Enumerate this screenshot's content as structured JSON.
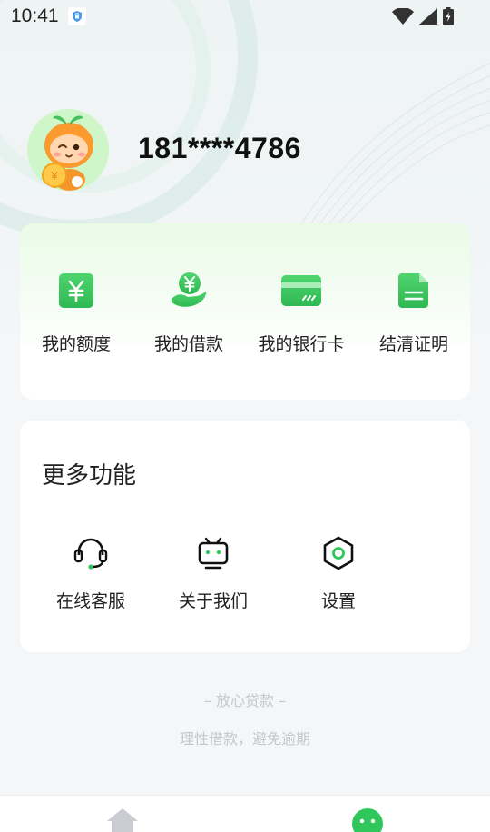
{
  "status_bar": {
    "time": "10:41",
    "icons": [
      "shield-icon",
      "wifi-icon",
      "signal-icon",
      "battery-charging-icon"
    ]
  },
  "profile": {
    "phone": "181****4786",
    "avatar": "orange-mascot-avatar"
  },
  "quick_actions": [
    {
      "label": "我的额度",
      "icon": "yuan-tile-icon"
    },
    {
      "label": "我的借款",
      "icon": "yuan-hand-icon"
    },
    {
      "label": "我的银行卡",
      "icon": "bank-card-icon"
    },
    {
      "label": "结清证明",
      "icon": "document-icon"
    }
  ],
  "more": {
    "title": "更多功能",
    "items": [
      {
        "label": "在线客服",
        "icon": "headset-icon"
      },
      {
        "label": "关于我们",
        "icon": "tv-robot-icon"
      },
      {
        "label": "设置",
        "icon": "hexagon-gear-icon"
      }
    ]
  },
  "footer": {
    "slogan": "– 放心贷款 –",
    "tip": "理性借款，避免逾期"
  },
  "tabbar": {
    "tabs": [
      {
        "icon": "home-icon"
      },
      {
        "icon": "profile-face-icon",
        "active": true
      }
    ]
  },
  "colors": {
    "accent": "#2fc75b",
    "accent_light": "#e9fbe6",
    "text": "#222222",
    "muted": "#c4c8cc",
    "tab_inactive": "#c9cdd1"
  }
}
